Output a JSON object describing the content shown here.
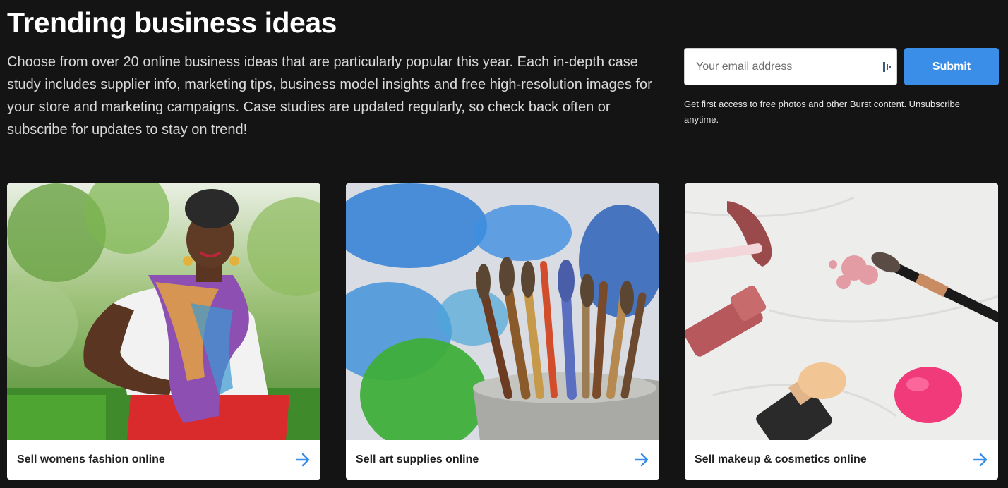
{
  "header": {
    "title": "Trending business ideas",
    "intro": "Choose from over 20 online business ideas that are particularly popular this year. Each in-depth case study includes supplier info, marketing tips, business model insights and free high-resolution images for your store and marketing campaigns. Case studies are updated regularly, so check back often or subscribe for updates to stay on trend!"
  },
  "signup": {
    "email_placeholder": "Your email address",
    "email_value": "",
    "submit_label": "Submit",
    "note": "Get first access to free photos and other Burst content. Unsubscribe anytime."
  },
  "cards": [
    {
      "title": "Sell womens fashion online",
      "icon": "arrow-right-icon",
      "image": "woman-in-scarf-photo"
    },
    {
      "title": "Sell art supplies online",
      "icon": "arrow-right-icon",
      "image": "paint-brushes-photo"
    },
    {
      "title": "Sell makeup & cosmetics online",
      "icon": "arrow-right-icon",
      "image": "makeup-products-photo"
    }
  ],
  "colors": {
    "background": "#141414",
    "accent": "#3b8ee8",
    "card_title": "#212121"
  }
}
